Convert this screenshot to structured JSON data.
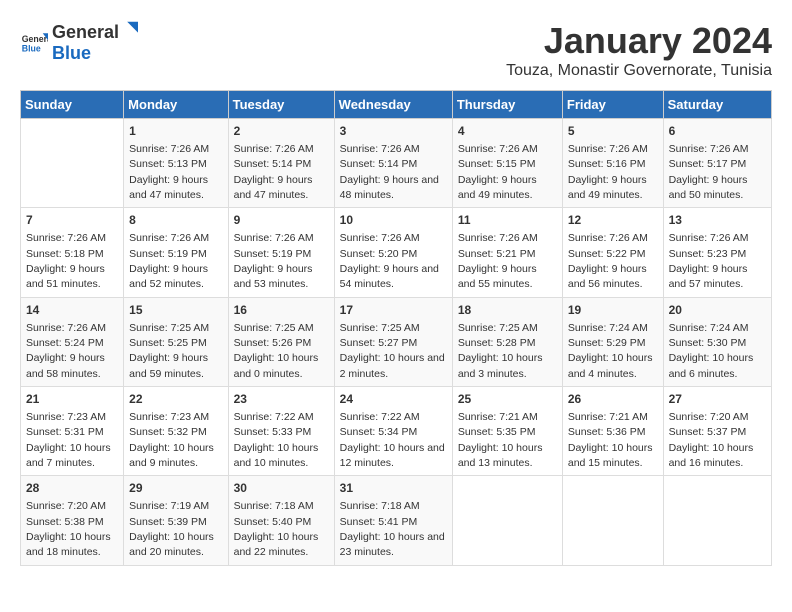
{
  "header": {
    "logo_general": "General",
    "logo_blue": "Blue",
    "title": "January 2024",
    "subtitle": "Touza, Monastir Governorate, Tunisia"
  },
  "calendar": {
    "days_of_week": [
      "Sunday",
      "Monday",
      "Tuesday",
      "Wednesday",
      "Thursday",
      "Friday",
      "Saturday"
    ],
    "weeks": [
      [
        {
          "day": "",
          "sunrise": "",
          "sunset": "",
          "daylight": ""
        },
        {
          "day": "1",
          "sunrise": "Sunrise: 7:26 AM",
          "sunset": "Sunset: 5:13 PM",
          "daylight": "Daylight: 9 hours and 47 minutes."
        },
        {
          "day": "2",
          "sunrise": "Sunrise: 7:26 AM",
          "sunset": "Sunset: 5:14 PM",
          "daylight": "Daylight: 9 hours and 47 minutes."
        },
        {
          "day": "3",
          "sunrise": "Sunrise: 7:26 AM",
          "sunset": "Sunset: 5:14 PM",
          "daylight": "Daylight: 9 hours and 48 minutes."
        },
        {
          "day": "4",
          "sunrise": "Sunrise: 7:26 AM",
          "sunset": "Sunset: 5:15 PM",
          "daylight": "Daylight: 9 hours and 49 minutes."
        },
        {
          "day": "5",
          "sunrise": "Sunrise: 7:26 AM",
          "sunset": "Sunset: 5:16 PM",
          "daylight": "Daylight: 9 hours and 49 minutes."
        },
        {
          "day": "6",
          "sunrise": "Sunrise: 7:26 AM",
          "sunset": "Sunset: 5:17 PM",
          "daylight": "Daylight: 9 hours and 50 minutes."
        }
      ],
      [
        {
          "day": "7",
          "sunrise": "Sunrise: 7:26 AM",
          "sunset": "Sunset: 5:18 PM",
          "daylight": "Daylight: 9 hours and 51 minutes."
        },
        {
          "day": "8",
          "sunrise": "Sunrise: 7:26 AM",
          "sunset": "Sunset: 5:19 PM",
          "daylight": "Daylight: 9 hours and 52 minutes."
        },
        {
          "day": "9",
          "sunrise": "Sunrise: 7:26 AM",
          "sunset": "Sunset: 5:19 PM",
          "daylight": "Daylight: 9 hours and 53 minutes."
        },
        {
          "day": "10",
          "sunrise": "Sunrise: 7:26 AM",
          "sunset": "Sunset: 5:20 PM",
          "daylight": "Daylight: 9 hours and 54 minutes."
        },
        {
          "day": "11",
          "sunrise": "Sunrise: 7:26 AM",
          "sunset": "Sunset: 5:21 PM",
          "daylight": "Daylight: 9 hours and 55 minutes."
        },
        {
          "day": "12",
          "sunrise": "Sunrise: 7:26 AM",
          "sunset": "Sunset: 5:22 PM",
          "daylight": "Daylight: 9 hours and 56 minutes."
        },
        {
          "day": "13",
          "sunrise": "Sunrise: 7:26 AM",
          "sunset": "Sunset: 5:23 PM",
          "daylight": "Daylight: 9 hours and 57 minutes."
        }
      ],
      [
        {
          "day": "14",
          "sunrise": "Sunrise: 7:26 AM",
          "sunset": "Sunset: 5:24 PM",
          "daylight": "Daylight: 9 hours and 58 minutes."
        },
        {
          "day": "15",
          "sunrise": "Sunrise: 7:25 AM",
          "sunset": "Sunset: 5:25 PM",
          "daylight": "Daylight: 9 hours and 59 minutes."
        },
        {
          "day": "16",
          "sunrise": "Sunrise: 7:25 AM",
          "sunset": "Sunset: 5:26 PM",
          "daylight": "Daylight: 10 hours and 0 minutes."
        },
        {
          "day": "17",
          "sunrise": "Sunrise: 7:25 AM",
          "sunset": "Sunset: 5:27 PM",
          "daylight": "Daylight: 10 hours and 2 minutes."
        },
        {
          "day": "18",
          "sunrise": "Sunrise: 7:25 AM",
          "sunset": "Sunset: 5:28 PM",
          "daylight": "Daylight: 10 hours and 3 minutes."
        },
        {
          "day": "19",
          "sunrise": "Sunrise: 7:24 AM",
          "sunset": "Sunset: 5:29 PM",
          "daylight": "Daylight: 10 hours and 4 minutes."
        },
        {
          "day": "20",
          "sunrise": "Sunrise: 7:24 AM",
          "sunset": "Sunset: 5:30 PM",
          "daylight": "Daylight: 10 hours and 6 minutes."
        }
      ],
      [
        {
          "day": "21",
          "sunrise": "Sunrise: 7:23 AM",
          "sunset": "Sunset: 5:31 PM",
          "daylight": "Daylight: 10 hours and 7 minutes."
        },
        {
          "day": "22",
          "sunrise": "Sunrise: 7:23 AM",
          "sunset": "Sunset: 5:32 PM",
          "daylight": "Daylight: 10 hours and 9 minutes."
        },
        {
          "day": "23",
          "sunrise": "Sunrise: 7:22 AM",
          "sunset": "Sunset: 5:33 PM",
          "daylight": "Daylight: 10 hours and 10 minutes."
        },
        {
          "day": "24",
          "sunrise": "Sunrise: 7:22 AM",
          "sunset": "Sunset: 5:34 PM",
          "daylight": "Daylight: 10 hours and 12 minutes."
        },
        {
          "day": "25",
          "sunrise": "Sunrise: 7:21 AM",
          "sunset": "Sunset: 5:35 PM",
          "daylight": "Daylight: 10 hours and 13 minutes."
        },
        {
          "day": "26",
          "sunrise": "Sunrise: 7:21 AM",
          "sunset": "Sunset: 5:36 PM",
          "daylight": "Daylight: 10 hours and 15 minutes."
        },
        {
          "day": "27",
          "sunrise": "Sunrise: 7:20 AM",
          "sunset": "Sunset: 5:37 PM",
          "daylight": "Daylight: 10 hours and 16 minutes."
        }
      ],
      [
        {
          "day": "28",
          "sunrise": "Sunrise: 7:20 AM",
          "sunset": "Sunset: 5:38 PM",
          "daylight": "Daylight: 10 hours and 18 minutes."
        },
        {
          "day": "29",
          "sunrise": "Sunrise: 7:19 AM",
          "sunset": "Sunset: 5:39 PM",
          "daylight": "Daylight: 10 hours and 20 minutes."
        },
        {
          "day": "30",
          "sunrise": "Sunrise: 7:18 AM",
          "sunset": "Sunset: 5:40 PM",
          "daylight": "Daylight: 10 hours and 22 minutes."
        },
        {
          "day": "31",
          "sunrise": "Sunrise: 7:18 AM",
          "sunset": "Sunset: 5:41 PM",
          "daylight": "Daylight: 10 hours and 23 minutes."
        },
        {
          "day": "",
          "sunrise": "",
          "sunset": "",
          "daylight": ""
        },
        {
          "day": "",
          "sunrise": "",
          "sunset": "",
          "daylight": ""
        },
        {
          "day": "",
          "sunrise": "",
          "sunset": "",
          "daylight": ""
        }
      ]
    ]
  }
}
